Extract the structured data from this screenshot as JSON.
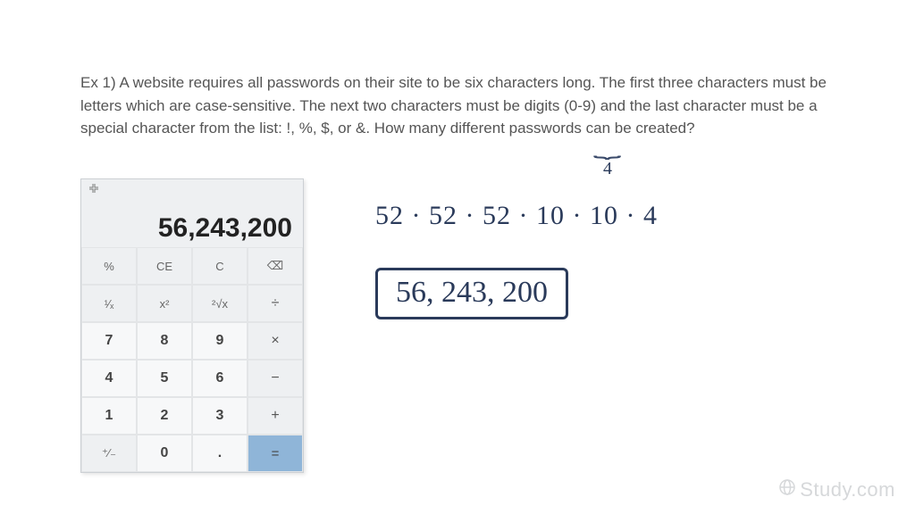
{
  "problem": {
    "text": "Ex 1) A website requires all passwords on their site to be six characters long. The first three characters must be letters which are case-sensitive. The next two characters must be digits (0-9) and the last character must be a special character from the list: !, %, $, or &. How many different passwords can be created?"
  },
  "brace_annotation": {
    "count": "4"
  },
  "calculator": {
    "display": "56,243,200",
    "rows": [
      [
        {
          "label": "%",
          "cls": "fn",
          "name": "percent-button"
        },
        {
          "label": "CE",
          "cls": "fn",
          "name": "clear-entry-button"
        },
        {
          "label": "C",
          "cls": "fn",
          "name": "clear-button"
        },
        {
          "label": "⌫",
          "cls": "fn",
          "name": "backspace-button"
        }
      ],
      [
        {
          "label": "¹⁄ₓ",
          "cls": "fn",
          "name": "reciprocal-button"
        },
        {
          "label": "x²",
          "cls": "fn",
          "name": "square-button"
        },
        {
          "label": "²√x",
          "cls": "fn",
          "name": "sqrt-button"
        },
        {
          "label": "÷",
          "cls": "op",
          "name": "divide-button"
        }
      ],
      [
        {
          "label": "7",
          "cls": "num",
          "name": "digit-7-button"
        },
        {
          "label": "8",
          "cls": "num",
          "name": "digit-8-button"
        },
        {
          "label": "9",
          "cls": "num",
          "name": "digit-9-button"
        },
        {
          "label": "×",
          "cls": "op",
          "name": "multiply-button"
        }
      ],
      [
        {
          "label": "4",
          "cls": "num",
          "name": "digit-4-button"
        },
        {
          "label": "5",
          "cls": "num",
          "name": "digit-5-button"
        },
        {
          "label": "6",
          "cls": "num",
          "name": "digit-6-button"
        },
        {
          "label": "−",
          "cls": "op",
          "name": "minus-button"
        }
      ],
      [
        {
          "label": "1",
          "cls": "num",
          "name": "digit-1-button"
        },
        {
          "label": "2",
          "cls": "num",
          "name": "digit-2-button"
        },
        {
          "label": "3",
          "cls": "num",
          "name": "digit-3-button"
        },
        {
          "label": "+",
          "cls": "op",
          "name": "plus-button"
        }
      ],
      [
        {
          "label": "⁺⁄₋",
          "cls": "fn",
          "name": "sign-button"
        },
        {
          "label": "0",
          "cls": "num",
          "name": "digit-0-button"
        },
        {
          "label": ".",
          "cls": "num",
          "name": "decimal-button"
        },
        {
          "label": "=",
          "cls": "eq",
          "name": "equals-button"
        }
      ]
    ]
  },
  "handwriting": {
    "expression": "52 · 52 · 52 · 10 · 10 · 4",
    "answer": "56, 243, 200"
  },
  "watermark": {
    "text": "Study.com"
  }
}
